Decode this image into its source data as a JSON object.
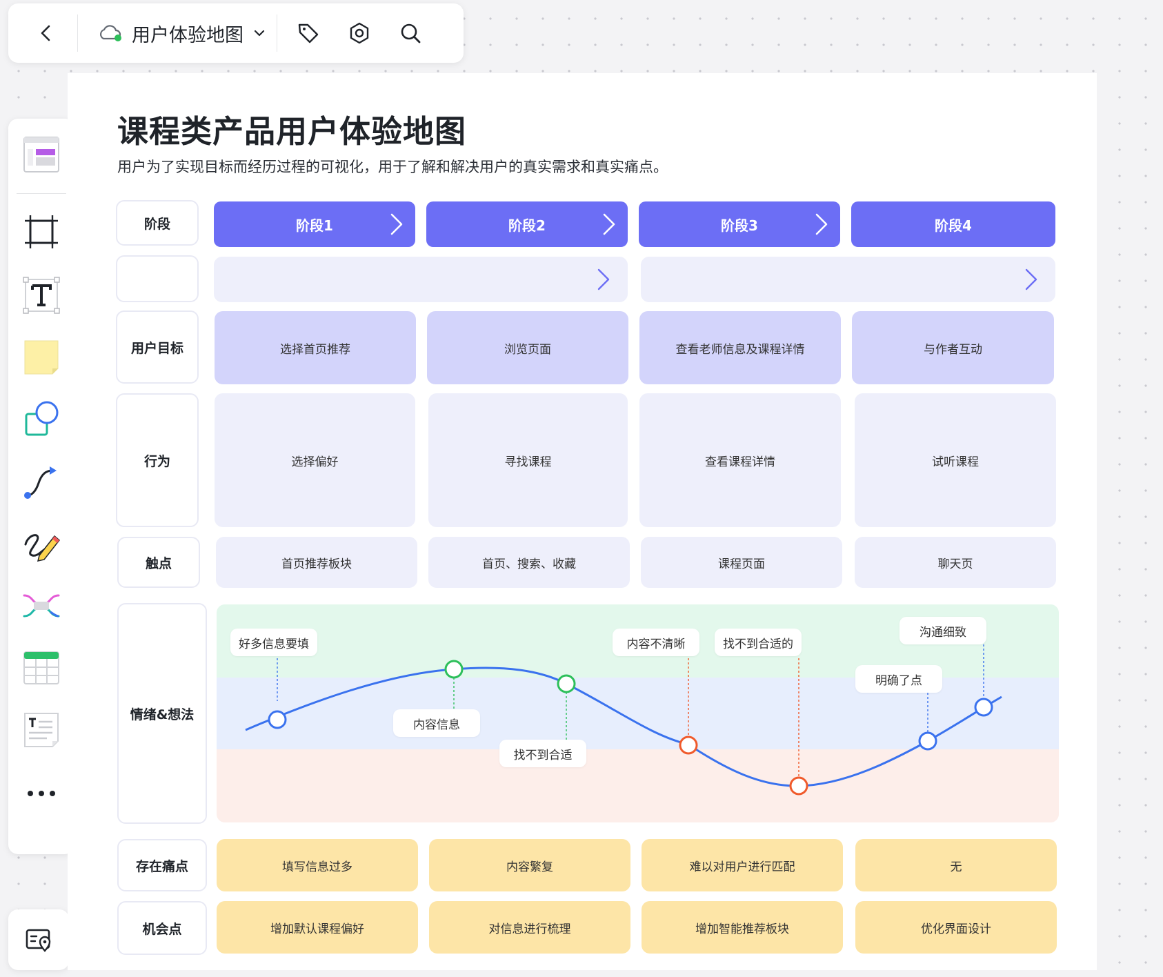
{
  "topbar": {
    "doc_title": "用户体验地图",
    "colors": {
      "cloud_status": "#2dbf5a"
    },
    "icons": [
      "back-icon",
      "cloud-icon",
      "chevron-down-icon",
      "tag-icon",
      "settings-icon",
      "search-icon"
    ]
  },
  "sidebar": {
    "tools": [
      "template-icon",
      "frame-icon",
      "text-icon",
      "sticky-note-icon",
      "shape-icon",
      "connector-icon",
      "pen-icon",
      "mindmap-icon",
      "table-icon",
      "text-doc-icon",
      "more-icon"
    ],
    "bottom": "minimap-icon"
  },
  "map": {
    "title": "课程类产品用户体验地图",
    "subtitle": "用户为了实现目标而经历过程的可视化，用于了解和解决用户的真实需求和真实痛点。",
    "row_labels": {
      "stage": "阶段",
      "goal": "用户目标",
      "behavior": "行为",
      "touchpoint": "触点",
      "emotion": "情绪&想法",
      "pain": "存在痛点",
      "opportunity": "机会点"
    },
    "stages": [
      "阶段1",
      "阶段2",
      "阶段3",
      "阶段4"
    ],
    "goals": [
      "选择首页推荐",
      "浏览页面",
      "查看老师信息及课程详情",
      "与作者互动"
    ],
    "behaviors": [
      "选择偏好",
      "寻找课程",
      "查看课程详情",
      "试听课程"
    ],
    "touchpoints": [
      "首页推荐板块",
      "首页、搜索、收藏",
      "课程页面",
      "聊天页"
    ],
    "pains": [
      "填写信息过多",
      "内容繁复",
      "难以对用户进行匹配",
      "无"
    ],
    "opportunities": [
      "增加默认课程偏好",
      "对信息进行梳理",
      "增加智能推荐板块",
      "优化界面设计"
    ],
    "emotion_notes": [
      "好多信息要填",
      "内容信息",
      "找不到合适",
      "内容不清晰",
      "找不到合适的",
      "明确了点",
      "沟通细致"
    ],
    "colors": {
      "stage": "#6c6ef5",
      "goal": "#d3d4fb",
      "light": "#eeeffb",
      "pain": "#fde5a7",
      "positive_lane": "#e3f8ec",
      "neutral_lane": "#e7eefd",
      "negative_lane": "#fdeeea",
      "curve": "#3a72ee",
      "positive_point": "#2dbf5a",
      "neutral_point": "#3a72ee",
      "negative_point": "#f05a2b"
    }
  }
}
